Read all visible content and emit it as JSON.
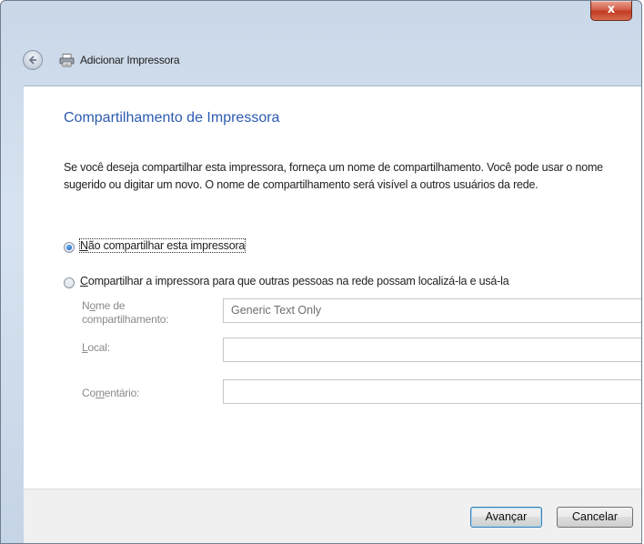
{
  "window": {
    "title": "Adicionar Impressora",
    "close_label": "x"
  },
  "page": {
    "heading": "Compartilhamento de Impressora",
    "description": "Se você deseja compartilhar esta impressora, forneça um nome de compartilhamento. Você pode usar o nome sugerido ou digitar um novo. O nome de compartilhamento será visível a outros usuários da rede."
  },
  "options": {
    "no_share": {
      "label_access": "N",
      "label_rest": "ão compartilhar esta impressora",
      "selected": true
    },
    "share": {
      "label_access": "C",
      "label_rest": "ompartilhar a impressora para que outras pessoas na rede possam localizá-la e usá-la",
      "selected": false
    }
  },
  "fields": {
    "share_name": {
      "label_pre": "N",
      "label_access": "o",
      "label_post": "me de",
      "label_line2": "compartilhamento:",
      "value": "Generic  Text Only"
    },
    "location": {
      "label_access": "L",
      "label_post": "ocal:",
      "value": ""
    },
    "comment": {
      "label_pre": "Co",
      "label_access": "m",
      "label_post": "entário:",
      "value": ""
    }
  },
  "buttons": {
    "next": "Avançar",
    "cancel": "Cancelar"
  }
}
